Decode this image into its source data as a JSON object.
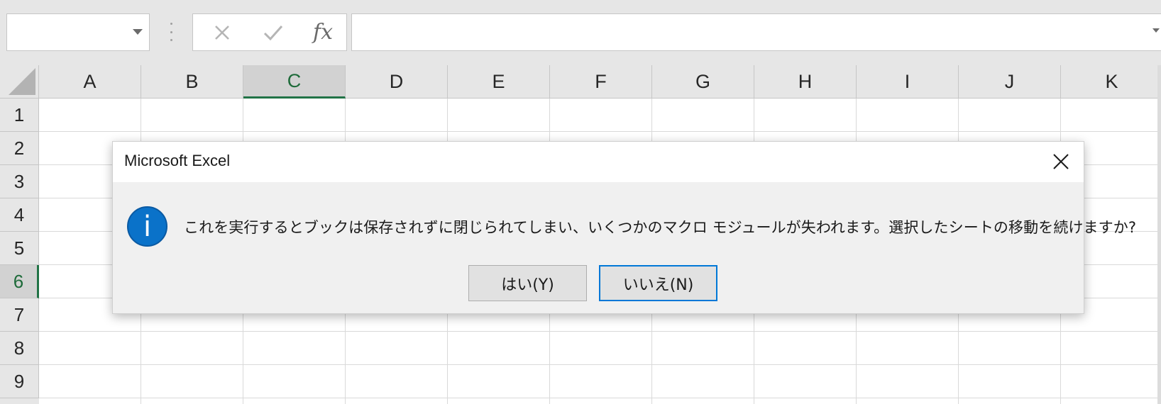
{
  "formula_bar": {
    "name_box_value": "",
    "formula_value": "",
    "fx_label": "fx"
  },
  "columns": [
    "A",
    "B",
    "C",
    "D",
    "E",
    "F",
    "G",
    "H",
    "I",
    "J",
    "K"
  ],
  "rows": [
    "1",
    "2",
    "3",
    "4",
    "5",
    "6",
    "7",
    "8",
    "9"
  ],
  "selected_column": "C",
  "selected_row": "6",
  "dialog": {
    "title": "Microsoft Excel",
    "icon": "info-icon",
    "icon_glyph": "i",
    "message": "これを実行するとブックは保存されずに閉じられてしまい、いくつかのマクロ モジュールが失われます。選択したシートの移動を続けますか?",
    "yes_label": "はい(Y)",
    "no_label": "いいえ(N)"
  },
  "colors": {
    "accent_green": "#217346",
    "dialog_info_blue": "#0a72c9",
    "default_button_border": "#0078d7"
  }
}
